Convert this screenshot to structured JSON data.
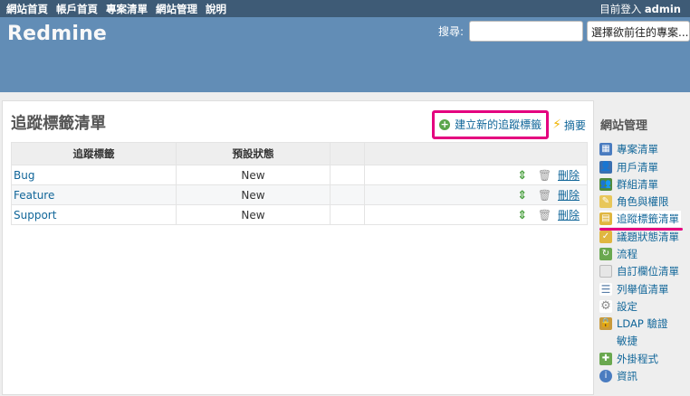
{
  "top_menu": {
    "items": [
      "網站首頁",
      "帳戶首頁",
      "專案清單",
      "網站管理",
      "說明"
    ],
    "active": "網站管理",
    "logged_in_label": "目前登入",
    "user": "admin"
  },
  "header": {
    "title": "Redmine",
    "search_label": "搜尋:",
    "search_value": "",
    "project_jump": "選擇欲前往的專案..."
  },
  "content": {
    "title": "追蹤標籤清單",
    "new_link": "建立新的追蹤標籤",
    "summary_link": "摘要",
    "table": {
      "headers": [
        "追蹤標籤",
        "預設狀態",
        "",
        ""
      ],
      "rows": [
        {
          "name": "Bug",
          "default_status": "New",
          "delete": "刪除"
        },
        {
          "name": "Feature",
          "default_status": "New",
          "delete": "刪除"
        },
        {
          "name": "Support",
          "default_status": "New",
          "delete": "刪除"
        }
      ]
    }
  },
  "sidebar": {
    "title": "網站管理",
    "items": [
      {
        "label": "專案清單",
        "icon": "projects-icon",
        "color": "#4a7cc0"
      },
      {
        "label": "用戶清單",
        "icon": "users-icon",
        "color": "#3a6fb0"
      },
      {
        "label": "群組清單",
        "icon": "groups-icon",
        "color": "#4f8a3c"
      },
      {
        "label": "角色與權限",
        "icon": "roles-icon",
        "color": "#e8c75a"
      },
      {
        "label": "追蹤標籤清單",
        "icon": "trackers-icon",
        "color": "#e0b640"
      },
      {
        "label": "議題狀態清單",
        "icon": "issue-statuses-icon",
        "color": "#e0b640"
      },
      {
        "label": "流程",
        "icon": "workflow-icon",
        "color": "#6aa84f"
      },
      {
        "label": "自訂欄位清單",
        "icon": "custom-fields-icon",
        "color": "#cfcfcf"
      },
      {
        "label": "列舉值清單",
        "icon": "enumerations-icon",
        "color": "#5a7fa8"
      },
      {
        "label": "設定",
        "icon": "settings-icon",
        "color": "#8a8a8a"
      },
      {
        "label": "LDAP 驗證",
        "icon": "ldap-icon",
        "color": "#c99a3a"
      },
      {
        "label": "敏捷",
        "icon": "",
        "color": ""
      },
      {
        "label": "外掛程式",
        "icon": "plugins-icon",
        "color": "#6aa84f"
      },
      {
        "label": "資訊",
        "icon": "info-icon",
        "color": "#4a7cc0"
      }
    ],
    "selected": "追蹤標籤清單"
  },
  "colors": {
    "top_menu_bg": "#3e5b76",
    "header_bg": "#628db6",
    "link": "#169",
    "highlight": "#e4007f"
  }
}
